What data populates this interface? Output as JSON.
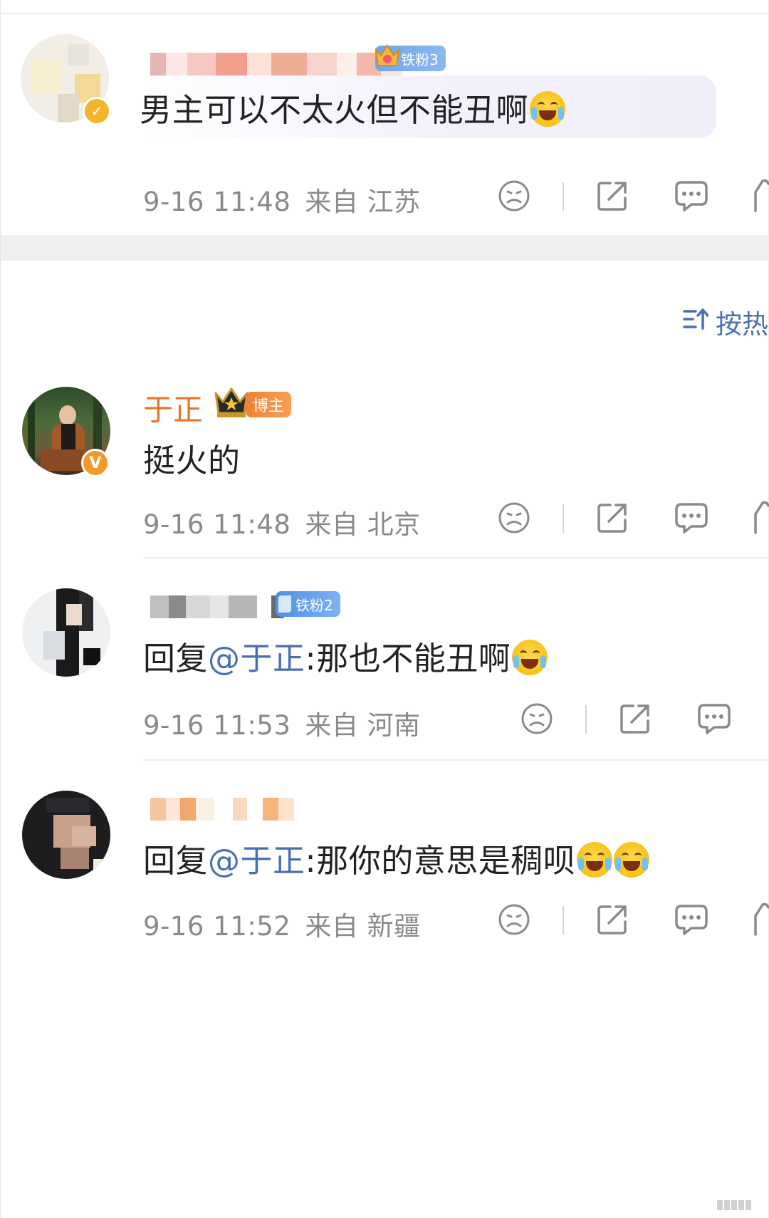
{
  "comments": [
    {
      "badge": "铁粉3",
      "text": "男主可以不太火但不能丑啊",
      "emoji": "crying-emoji",
      "time": "9-16 11:48",
      "location": "来自 江苏"
    },
    {
      "name": "于正",
      "badge": "博主",
      "text": "挺火的",
      "time": "9-16 11:48",
      "location": "来自 北京"
    },
    {
      "badge": "铁粉2",
      "reply_prefix": "回复",
      "mention": "@于正",
      "text": ":那也不能丑啊",
      "emoji": "laughing-emoji",
      "time": "9-16 11:53",
      "location": "来自 河南"
    },
    {
      "reply_prefix": "回复",
      "mention": "@于正",
      "text": ":那你的意思是稠呗",
      "emoji": "crying-laughing-emoji",
      "time": "9-16 11:52",
      "location": "来自 新疆"
    }
  ],
  "sort": {
    "label": "按热"
  },
  "colors": {
    "mention": "#4a6fb3",
    "blogger_name": "#e8752a",
    "fan_badge": "#6ea6ec",
    "blogger_badge": "#f08a3c",
    "meta": "#8a8a8a"
  }
}
